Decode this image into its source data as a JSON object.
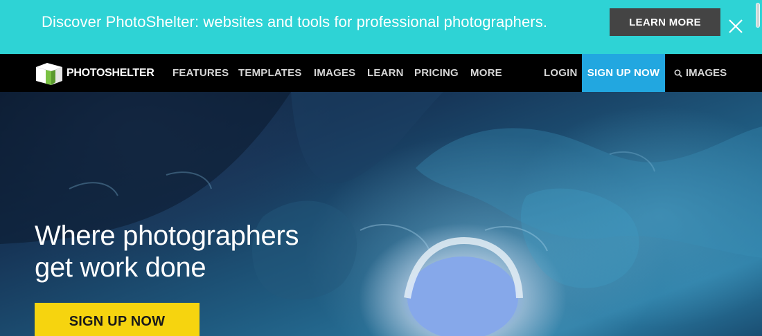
{
  "promo": {
    "text": "Discover PhotoShelter: websites and tools for professional photographers.",
    "button_label": "LEARN MORE",
    "close_icon": "close-icon"
  },
  "nav": {
    "logo_text": "PHOTOSHELTER",
    "links": [
      "FEATURES",
      "TEMPLATES",
      "IMAGES",
      "LEARN",
      "PRICING",
      "MORE"
    ],
    "login": "LOGIN",
    "signup": "SIGN UP NOW",
    "search": "IMAGES"
  },
  "hero": {
    "title_line1": "Where photographers",
    "title_line2": "get work done",
    "cta_label": "SIGN UP NOW"
  },
  "colors": {
    "promo_bg": "#2ed3d5",
    "promo_button": "#444444",
    "nav_bg": "#000000",
    "signup_bg": "#22a7e0",
    "cta_bg": "#f6d40f"
  }
}
